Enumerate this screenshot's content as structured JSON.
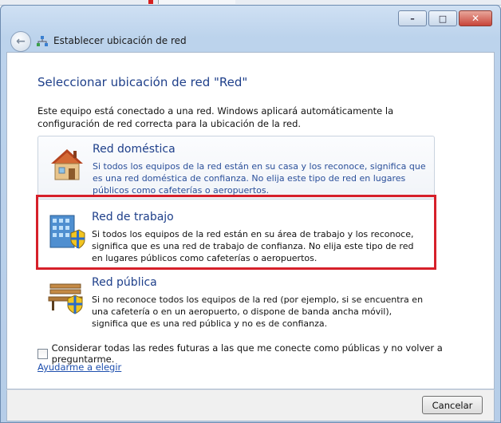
{
  "window": {
    "title": "Establecer ubicación de red",
    "controls": {
      "minimize": "–",
      "maximize": "□",
      "close": "✕"
    }
  },
  "content": {
    "heading": "Seleccionar ubicación de red \"Red\"",
    "intro": "Este equipo está conectado a una red. Windows aplicará automáticamente la configuración de red correcta para la ubicación de la red.",
    "options": [
      {
        "title": "Red doméstica",
        "description": "Si todos los equipos de la red están en su casa y los reconoce, significa que es una red doméstica de confianza. No elija este tipo de red en lugares públicos como cafeterías o aeropuertos.",
        "icon": "house-icon"
      },
      {
        "title": "Red de trabajo",
        "description": "Si todos los equipos de la red están en su área de trabajo y los reconoce, significa que es una red de trabajo de confianza. No elija este tipo de red en lugares públicos como cafeterías o aeropuertos.",
        "icon": "office-building-icon"
      },
      {
        "title": "Red pública",
        "description": "Si no reconoce todos los equipos de la red (por ejemplo, si se encuentra en una cafetería o en un aeropuerto, o dispone de banda ancha móvil), significa que es una red pública y no es de confianza.",
        "icon": "park-bench-icon"
      }
    ],
    "checkbox_label": "Considerar todas las redes futuras a las que me conecte como públicas y no volver a preguntarme.",
    "help_link": "Ayudarme a elegir"
  },
  "footer": {
    "cancel_label": "Cancelar"
  },
  "colors": {
    "heading": "#1e3f8a",
    "highlight": "#d6202a",
    "link": "#1e4fae"
  }
}
